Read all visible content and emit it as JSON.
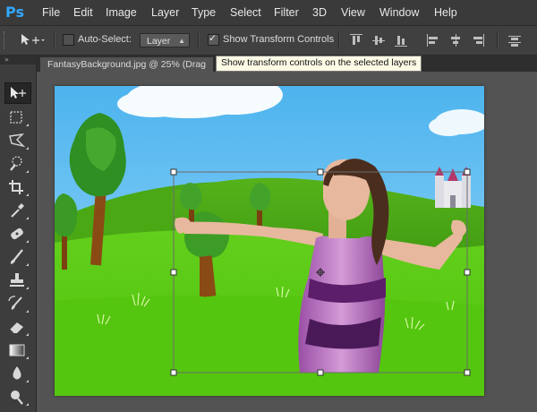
{
  "app": {
    "logo": "Ps"
  },
  "menu": [
    "File",
    "Edit",
    "Image",
    "Layer",
    "Type",
    "Select",
    "Filter",
    "3D",
    "View",
    "Window",
    "Help"
  ],
  "options_bar": {
    "auto_select_label": "Auto-Select:",
    "auto_select_checked": false,
    "auto_select_target": "Layer",
    "show_transform_label": "Show Transform Controls",
    "show_transform_checked": true
  },
  "tooltip": "Show transform controls on the selected layers",
  "document_tab": "FantasyBackground.jpg @ 25% (Drag",
  "tools": [
    "move-tool",
    "marquee-tool",
    "lasso-tool",
    "quick-selection-tool",
    "crop-tool",
    "eyedropper-tool",
    "spot-healing-tool",
    "brush-tool",
    "clone-stamp-tool",
    "history-brush-tool",
    "eraser-tool",
    "gradient-tool",
    "blur-tool",
    "dodge-tool"
  ],
  "colors": {
    "ui_dark": "#3a3a3a",
    "ui_panel": "#535353",
    "ps_blue": "#31a8ff",
    "sky": "#5fbcf2",
    "grass": "#55c81a",
    "dress": "#b46bbd"
  }
}
